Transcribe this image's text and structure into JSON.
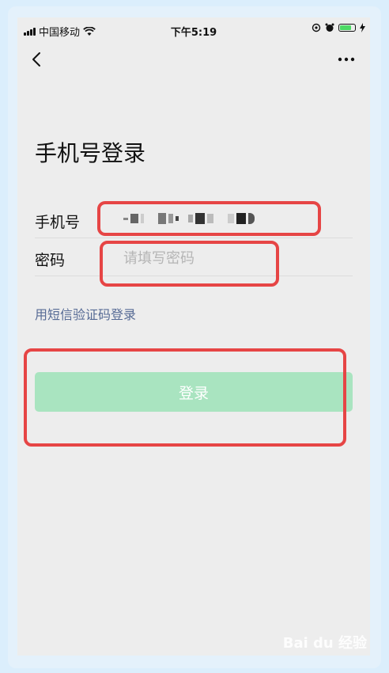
{
  "status_bar": {
    "carrier": "中国移动",
    "time": "下午5:19"
  },
  "page": {
    "title": "手机号登录"
  },
  "form": {
    "phone_label": "手机号",
    "phone_value": "+86 1** **** **0",
    "password_label": "密码",
    "password_placeholder": "请填写密码"
  },
  "links": {
    "sms_login": "用短信验证码登录"
  },
  "buttons": {
    "login": "登录"
  },
  "watermark": {
    "text": "Bai du 经验"
  },
  "colors": {
    "background": "#ededed",
    "link": "#576b95",
    "login_button_disabled": "#a9e4c0",
    "annotation": "#e64545"
  },
  "icons": {
    "back": "back-chevron-icon",
    "more": "more-dots-icon",
    "wifi": "wifi-icon",
    "signal": "signal-icon",
    "battery": "battery-icon"
  }
}
